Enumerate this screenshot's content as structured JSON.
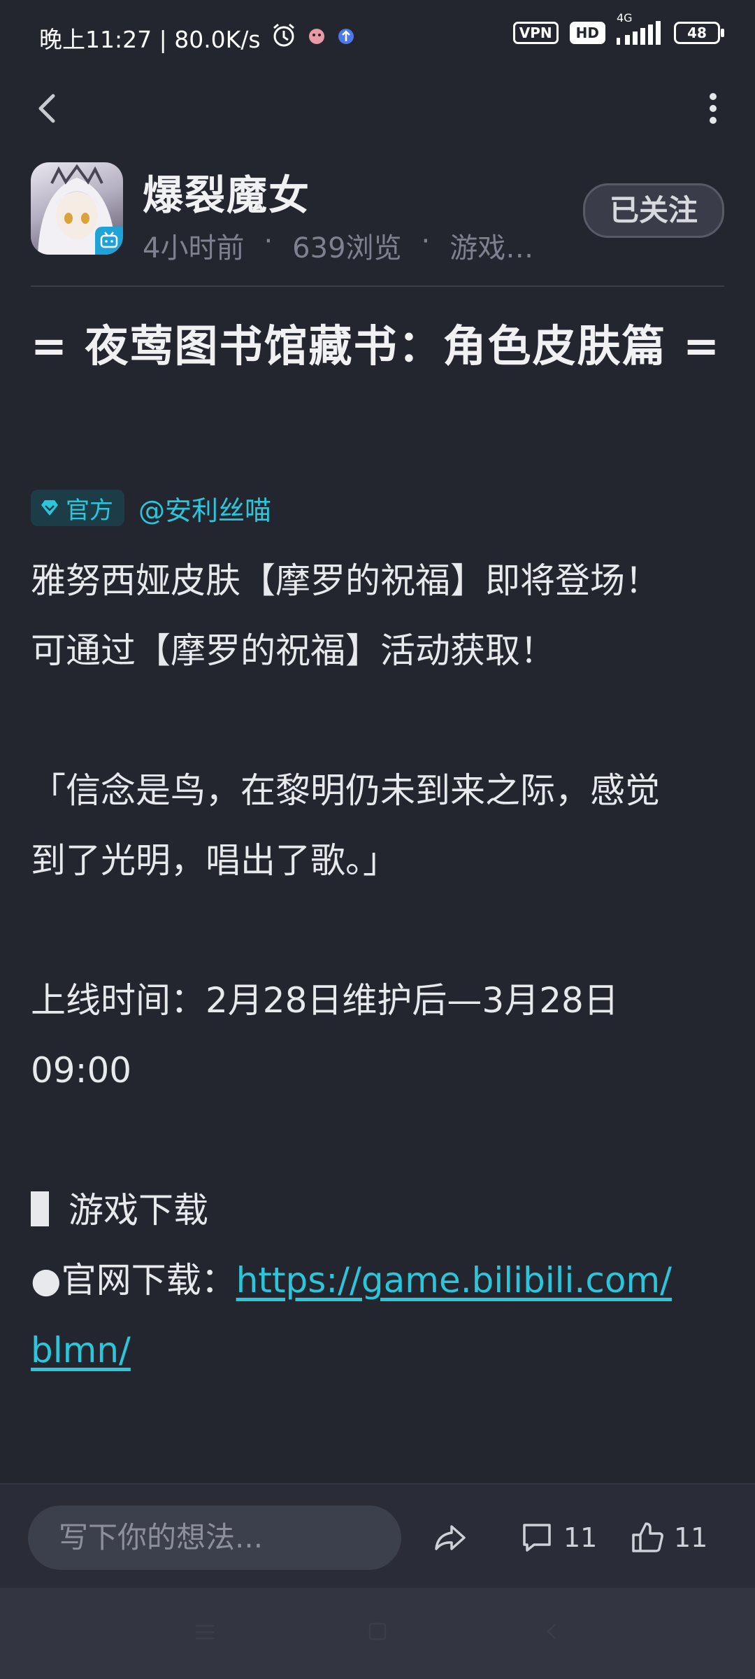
{
  "status_bar": {
    "time_speed": "晚上11:27 | 80.0K/s",
    "vpn": "VPN",
    "hd": "HD",
    "network": "4G",
    "battery": "48"
  },
  "author": {
    "name": "爆裂魔女",
    "time_ago": "4小时前",
    "views": "639浏览",
    "category": "游戏…",
    "follow_label": "已关注"
  },
  "post": {
    "title": "= 夜莺图书馆藏书：角色皮肤篇 =",
    "official_tag": "官方",
    "mention": "@安利丝喵",
    "lines": {
      "l1": "雅努西娅皮肤【摩罗的祝福】即将登场！",
      "l2": "可通过【摩罗的祝福】活动获取！",
      "l3": "「信念是鸟，在黎明仍未到来之际，感觉",
      "l4": "到了光明，唱出了歌。」",
      "l5": "上线时间：2月28日维护后—3月28日",
      "l6": "09:00",
      "section": "游戏下载",
      "download_prefix": "●官网下载：",
      "link_part1": "https://game.bilibili.com/",
      "link_part2": "blmn/"
    }
  },
  "bottom": {
    "placeholder": "写下你的想法...",
    "comments": "11",
    "likes": "11"
  },
  "colors": {
    "background": "#23252f",
    "accent": "#2bc6d9"
  }
}
